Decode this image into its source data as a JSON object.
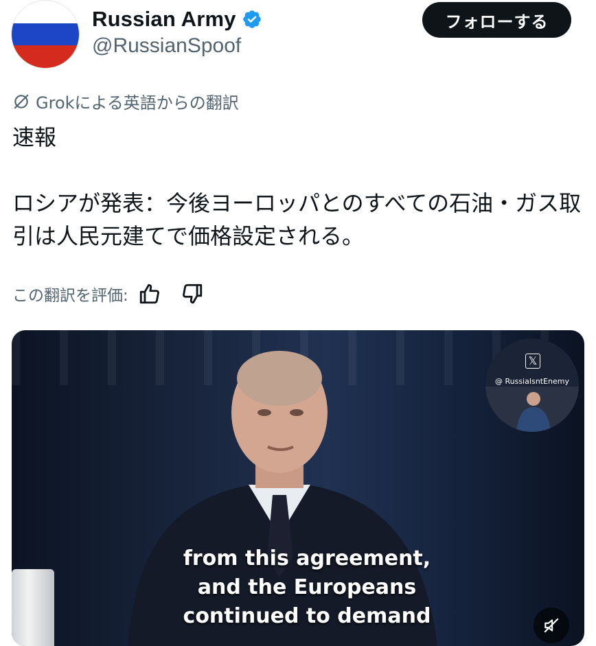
{
  "post": {
    "author": {
      "display_name": "Russian Army",
      "handle": "@RussianSpoof",
      "verified": true,
      "avatar_flag_colors": [
        "#ffffff",
        "#1c46c6",
        "#d52b1e"
      ]
    },
    "follow_label": "フォローする",
    "translation_note": "Grokによる英語からの翻訳",
    "text": "速報\n\nロシアが発表：今後ヨーロッパとのすべての石油・ガス取引は人民元建てで価格設定される。",
    "rate_label": "この翻訳を評価:"
  },
  "video": {
    "subtitle_lines": [
      "from this agreement,",
      "and the Europeans",
      "continued to demand"
    ],
    "watermark": "@ RussiaIsntEnemy"
  },
  "icons": {
    "verified": "verified-badge-icon",
    "grok": "grok-icon",
    "thumbs_up": "thumbs-up-icon",
    "thumbs_down": "thumbs-down-icon",
    "mute": "mute-icon",
    "x_logo": "x-logo-icon"
  },
  "colors": {
    "verified_blue": "#1d9bf0",
    "follow_bg": "#0f1419",
    "muted_text": "#536471"
  }
}
